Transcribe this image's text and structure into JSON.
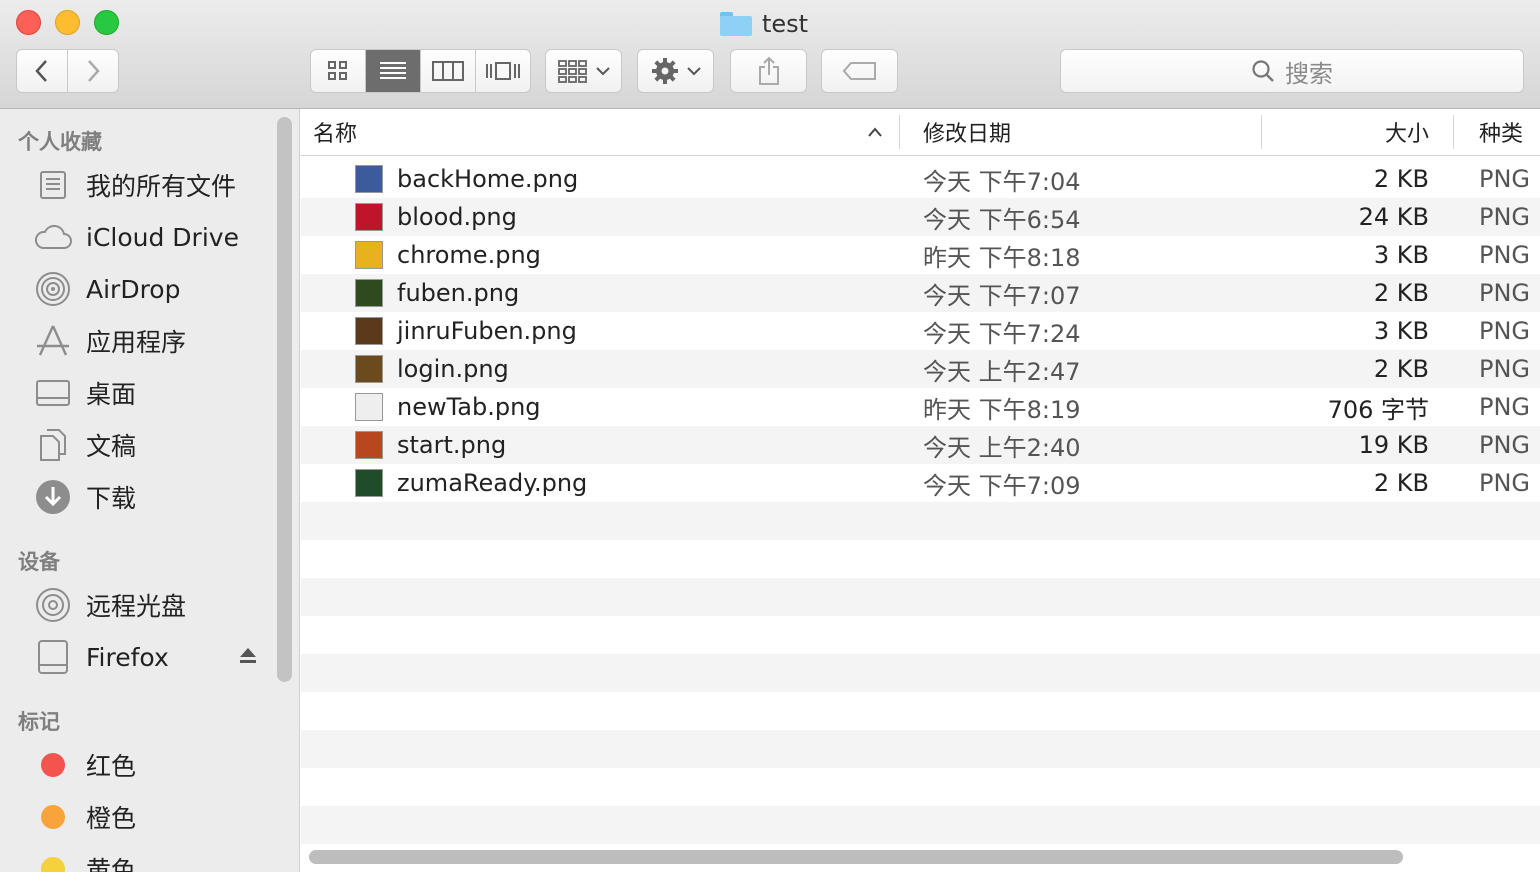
{
  "window": {
    "title": "test"
  },
  "toolbar": {
    "back_icon": "chevron-left-icon",
    "forward_icon": "chevron-right-icon",
    "view_modes": [
      "icon-view",
      "list-view",
      "column-view",
      "cover-flow-view"
    ],
    "active_view": "list-view",
    "arrange_icon": "arrange-grid-icon",
    "action_icon": "gear-icon",
    "share_icon": "share-icon",
    "tag_icon": "tag-icon"
  },
  "search": {
    "placeholder": "搜索",
    "icon": "search-icon"
  },
  "sidebar": {
    "favorites_heading": "个人收藏",
    "favorites": [
      {
        "label": "我的所有文件",
        "icon": "all-files-icon"
      },
      {
        "label": "iCloud Drive",
        "icon": "cloud-icon"
      },
      {
        "label": "AirDrop",
        "icon": "airdrop-icon"
      },
      {
        "label": "应用程序",
        "icon": "applications-icon"
      },
      {
        "label": "桌面",
        "icon": "desktop-icon"
      },
      {
        "label": "文稿",
        "icon": "documents-icon"
      },
      {
        "label": "下载",
        "icon": "download-icon"
      }
    ],
    "devices_heading": "设备",
    "devices": [
      {
        "label": "远程光盘",
        "icon": "disc-icon"
      },
      {
        "label": "Firefox",
        "icon": "drive-icon"
      }
    ],
    "tags_heading": "标记",
    "tags": [
      {
        "label": "红色",
        "color": "#f4534e"
      },
      {
        "label": "橙色",
        "color": "#f8a33b"
      },
      {
        "label": "黄色",
        "color": "#f5d13b"
      }
    ]
  },
  "columns": {
    "name": "名称",
    "date": "修改日期",
    "size": "大小",
    "kind": "种类"
  },
  "files": [
    {
      "name": "backHome.png",
      "date": "今天 下午7:04",
      "size": "2 KB",
      "kind": "PNG",
      "thumb": "#3b5b9a"
    },
    {
      "name": "blood.png",
      "date": "今天 下午6:54",
      "size": "24 KB",
      "kind": "PNG",
      "thumb": "#c0142a"
    },
    {
      "name": "chrome.png",
      "date": "昨天 下午8:18",
      "size": "3 KB",
      "kind": "PNG",
      "thumb": "#e8b21e"
    },
    {
      "name": "fuben.png",
      "date": "今天 下午7:07",
      "size": "2 KB",
      "kind": "PNG",
      "thumb": "#2f4a1e"
    },
    {
      "name": "jinruFuben.png",
      "date": "今天 下午7:24",
      "size": "3 KB",
      "kind": "PNG",
      "thumb": "#5a3a1a"
    },
    {
      "name": "login.png",
      "date": "今天 上午2:47",
      "size": "2 KB",
      "kind": "PNG",
      "thumb": "#6b4a1e"
    },
    {
      "name": "newTab.png",
      "date": "昨天 下午8:19",
      "size": "706 字节",
      "kind": "PNG",
      "thumb": "#eeeeee"
    },
    {
      "name": "start.png",
      "date": "今天 上午2:40",
      "size": "19 KB",
      "kind": "PNG",
      "thumb": "#b8461e"
    },
    {
      "name": "zumaReady.png",
      "date": "今天 下午7:09",
      "size": "2 KB",
      "kind": "PNG",
      "thumb": "#1f4d2a"
    }
  ]
}
